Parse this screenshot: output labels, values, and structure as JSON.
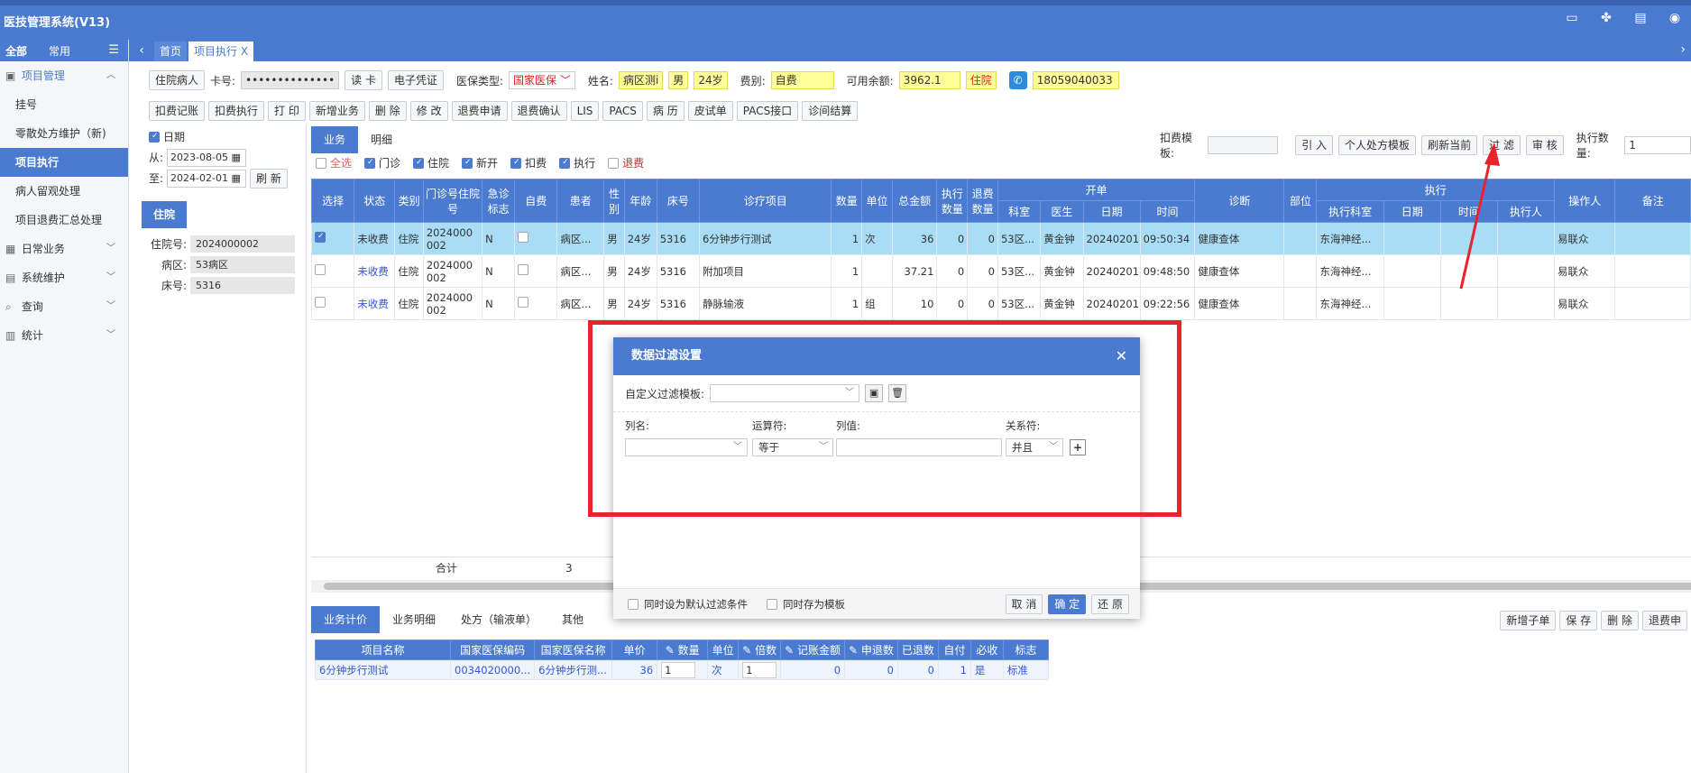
{
  "app": {
    "title": "医技管理系统(V13)"
  },
  "sidebar": {
    "tabs": [
      "全部",
      "常用"
    ],
    "groups": [
      {
        "label": "项目管理",
        "items": [
          "挂号",
          "零散处方维护（新)",
          "项目执行",
          "病人留观处理",
          "项目退费汇总处理"
        ]
      },
      {
        "label": "日常业务"
      },
      {
        "label": "系统维护"
      },
      {
        "label": "查询"
      },
      {
        "label": "统计"
      }
    ]
  },
  "tabs": [
    "首页",
    "项目执行 X"
  ],
  "toolbar1": {
    "inpatient_btn": "住院病人",
    "card_label": "卡号:",
    "card_value": "••••••••••••••",
    "read_card": "读 卡",
    "e_cert": "电子凭证",
    "insurance_label": "医保类型:",
    "insurance_value": "国家医保",
    "name_label": "姓名:",
    "name_value": "病区测i",
    "gender": "男",
    "age": "24岁",
    "fee_label": "费别:",
    "fee_value": "自费",
    "balance_label": "可用余额:",
    "balance_value": "3962.1",
    "status_value": "住院",
    "phone": "18059040033"
  },
  "toolbar2": [
    "扣费记账",
    "扣费执行",
    "打 印",
    "新增业务",
    "删 除",
    "修 改",
    "退费申请",
    "退费确认",
    "LIS",
    "PACS",
    "病 历",
    "皮试单",
    "PACS接口",
    "诊间结算"
  ],
  "left_panel": {
    "date_label": "日期",
    "from_label": "从:",
    "from_date": "2023-08-05",
    "to_label": "至:",
    "to_date": "2024-02-01",
    "refresh": "刷 新",
    "tag": "住院",
    "info": [
      {
        "k": "住院号:",
        "v": "2024000002"
      },
      {
        "k": "病区:",
        "v": "53病区"
      },
      {
        "k": "床号:",
        "v": "5316"
      }
    ]
  },
  "subtabs": [
    "业务",
    "明细"
  ],
  "right_tools": {
    "template_label": "扣费模板:",
    "buttons": [
      "引 入",
      "个人处方模板",
      "刷新当前",
      "过 滤",
      "审 核"
    ],
    "exec_label": "执行数量:",
    "exec_value": "1"
  },
  "filters": [
    "全选",
    "门诊",
    "住院",
    "新开",
    "扣费",
    "执行",
    "退费"
  ],
  "table": {
    "group_headers": {
      "open": "开单",
      "exec": "执行"
    },
    "headers": [
      "选择",
      "状态",
      "类别",
      "门诊号住院号",
      "急诊标志",
      "自费",
      "患者",
      "性别",
      "年龄",
      "床号",
      "诊疗项目",
      "数量",
      "单位",
      "总金额",
      "执行数量",
      "退费数量",
      "科室",
      "医生",
      "日期",
      "时间",
      "诊断",
      "部位",
      "执行科室",
      "日期",
      "时间",
      "执行人",
      "操作人",
      "备注"
    ],
    "rows": [
      [
        "",
        "未收费",
        "住院",
        "2024000002",
        "N",
        "",
        "病区...",
        "男",
        "24岁",
        "5316",
        "6分钟步行测试",
        "1",
        "次",
        "36",
        "0",
        "0",
        "53区...",
        "黄金钟",
        "20240201",
        "09:50:34",
        "健康查体",
        "",
        "东海神经...",
        "",
        "",
        "",
        "易联众",
        ""
      ],
      [
        "",
        "未收费",
        "住院",
        "2024000002",
        "N",
        "",
        "病区...",
        "男",
        "24岁",
        "5316",
        "附加项目",
        "1",
        "",
        "37.21",
        "0",
        "0",
        "53区...",
        "黄金钟",
        "20240201",
        "09:48:50",
        "健康查体",
        "",
        "东海神经...",
        "",
        "",
        "",
        "易联众",
        ""
      ],
      [
        "",
        "未收费",
        "住院",
        "2024000002",
        "N",
        "",
        "病区...",
        "男",
        "24岁",
        "5316",
        "静脉输液",
        "1",
        "组",
        "10",
        "0",
        "0",
        "53区...",
        "黄金钟",
        "20240201",
        "09:22:56",
        "健康查体",
        "",
        "东海神经...",
        "",
        "",
        "",
        "易联众",
        ""
      ]
    ],
    "sum_label": "合计",
    "sum_value": "3"
  },
  "bottom_tabs": [
    "业务计价",
    "业务明细",
    "处方（输液单）",
    "其他"
  ],
  "bottom_tools": [
    "新增子单",
    "保 存",
    "删 除",
    "退费申"
  ],
  "sub_table": {
    "headers": [
      "项目名称",
      "国家医保编码",
      "国家医保名称",
      "单价",
      "数量",
      "单位",
      "倍数",
      "记账金额",
      "申退数",
      "已退数",
      "自付",
      "必收",
      "标志"
    ],
    "row": [
      "6分钟步行测试",
      "0034020000...",
      "6分钟步行测...",
      "36",
      "1",
      "次",
      "1",
      "0",
      "0",
      "0",
      "1",
      "是",
      "标准"
    ]
  },
  "dialog": {
    "title": "数据过滤设置",
    "template_label": "自定义过滤模板:",
    "col_label": "列名:",
    "op_label": "运算符:",
    "val_label": "列值:",
    "rel_label": "关系符:",
    "op_value": "等于",
    "rel_value": "并且",
    "opt1": "同时设为默认过滤条件",
    "opt2": "同时存为模板",
    "cancel": "取 消",
    "ok": "确 定",
    "reset": "还 原"
  },
  "colors": {
    "primary": "#4a7bd0",
    "highlight": "#e8232b",
    "selected_row": "#a9dcf5"
  }
}
